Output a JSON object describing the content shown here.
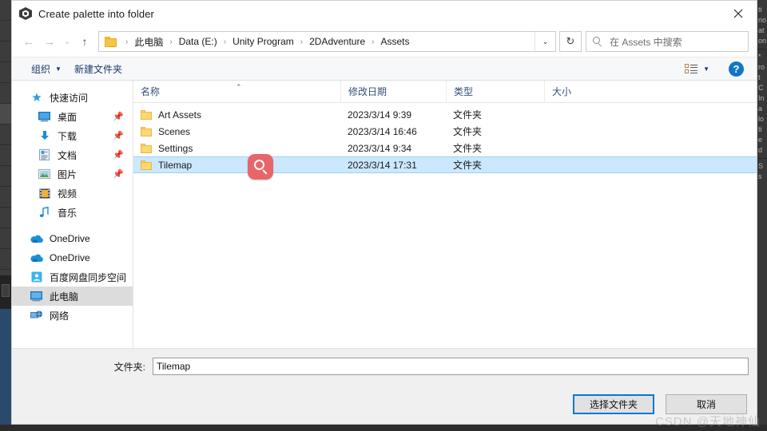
{
  "window": {
    "title": "Create palette into folder",
    "app_icon": "unity-hexagon-icon",
    "close_label": "✕"
  },
  "addressbar": {
    "back_icon": "arrow-left-icon",
    "forward_icon": "arrow-right-icon",
    "history_icon": "chevron-down-icon",
    "up_icon": "arrow-up-icon",
    "folder_icon": "folder-icon",
    "crumbs": [
      "此电脑",
      "Data (E:)",
      "Unity Program",
      "2DAdventure",
      "Assets"
    ],
    "separator": "›",
    "dropdown_icon": "chevron-down-icon",
    "refresh_icon": "refresh-icon",
    "refresh_glyph": "↻",
    "search": {
      "icon": "search-icon",
      "placeholder": "在 Assets 中搜索",
      "value": ""
    }
  },
  "commandbar": {
    "organize_label": "组织",
    "organize_caret": "▼",
    "new_folder_label": "新建文件夹",
    "view_icon": "view-layout-icon",
    "view_caret": "▼",
    "help_icon": "help-icon",
    "help_glyph": "?"
  },
  "navpane": {
    "groups": [
      {
        "header": {
          "label": "快速访问",
          "icon": "pin-star-icon",
          "glyph": "📌"
        },
        "items": [
          {
            "label": "桌面",
            "icon": "desktop-icon",
            "pinned": true,
            "selected": false
          },
          {
            "label": "下载",
            "icon": "downloads-icon",
            "pinned": true,
            "selected": false
          },
          {
            "label": "文档",
            "icon": "documents-icon",
            "pinned": true,
            "selected": false
          },
          {
            "label": "图片",
            "icon": "pictures-icon",
            "pinned": true,
            "selected": false
          },
          {
            "label": "视频",
            "icon": "videos-icon",
            "pinned": false,
            "selected": false
          },
          {
            "label": "音乐",
            "icon": "music-icon",
            "pinned": false,
            "selected": false
          }
        ]
      },
      {
        "items": [
          {
            "label": "OneDrive",
            "icon": "onedrive-cloud-icon",
            "pinned": false,
            "selected": false
          },
          {
            "label": "OneDrive",
            "icon": "onedrive-cloud-icon",
            "pinned": false,
            "selected": false
          },
          {
            "label": "百度网盘同步空间",
            "icon": "baidu-netdisk-icon",
            "pinned": false,
            "selected": false
          },
          {
            "label": "此电脑",
            "icon": "this-pc-icon",
            "pinned": false,
            "selected": true
          },
          {
            "label": "网络",
            "icon": "network-icon",
            "pinned": false,
            "selected": false
          }
        ]
      }
    ],
    "pin_glyph": "📌"
  },
  "filelist": {
    "columns": [
      {
        "key": "name",
        "label": "名称",
        "sorted": true,
        "sort_glyph": "⌃"
      },
      {
        "key": "date",
        "label": "修改日期",
        "sorted": false
      },
      {
        "key": "type",
        "label": "类型",
        "sorted": false
      },
      {
        "key": "size",
        "label": "大小",
        "sorted": false
      }
    ],
    "rows": [
      {
        "name": "Art Assets",
        "date": "2023/3/14 9:39",
        "type": "文件夹",
        "size": "",
        "icon": "folder-icon",
        "selected": false
      },
      {
        "name": "Scenes",
        "date": "2023/3/14 16:46",
        "type": "文件夹",
        "size": "",
        "icon": "folder-icon",
        "selected": false
      },
      {
        "name": "Settings",
        "date": "2023/3/14 9:34",
        "type": "文件夹",
        "size": "",
        "icon": "folder-icon",
        "selected": false
      },
      {
        "name": "Tilemap",
        "date": "2023/3/14 17:31",
        "type": "文件夹",
        "size": "",
        "icon": "folder-icon",
        "selected": true
      }
    ]
  },
  "annotation": {
    "magnifier_icon": "magnifier-badge-icon",
    "color": "#e8656a"
  },
  "footer": {
    "folder_label": "文件夹:",
    "folder_value": "Tilemap",
    "folder_placeholder": "",
    "confirm_label": "选择文件夹",
    "cancel_label": "取消"
  },
  "watermark": {
    "text": "CSDN @天地神仙"
  },
  "colors": {
    "selection_blue": "#cce8ff",
    "accent_blue": "#0078d7",
    "folder_yellow": "#fbd775",
    "annotation_red": "#e8656a",
    "nav_selected_gray": "#dcdcdc"
  },
  "background": {
    "right_lines": [
      "ti",
      "no",
      "at",
      "on",
      "*",
      "ro",
      "t",
      "C",
      "In",
      "a",
      "lo",
      "ti",
      "e",
      "d",
      "S",
      "s"
    ]
  }
}
